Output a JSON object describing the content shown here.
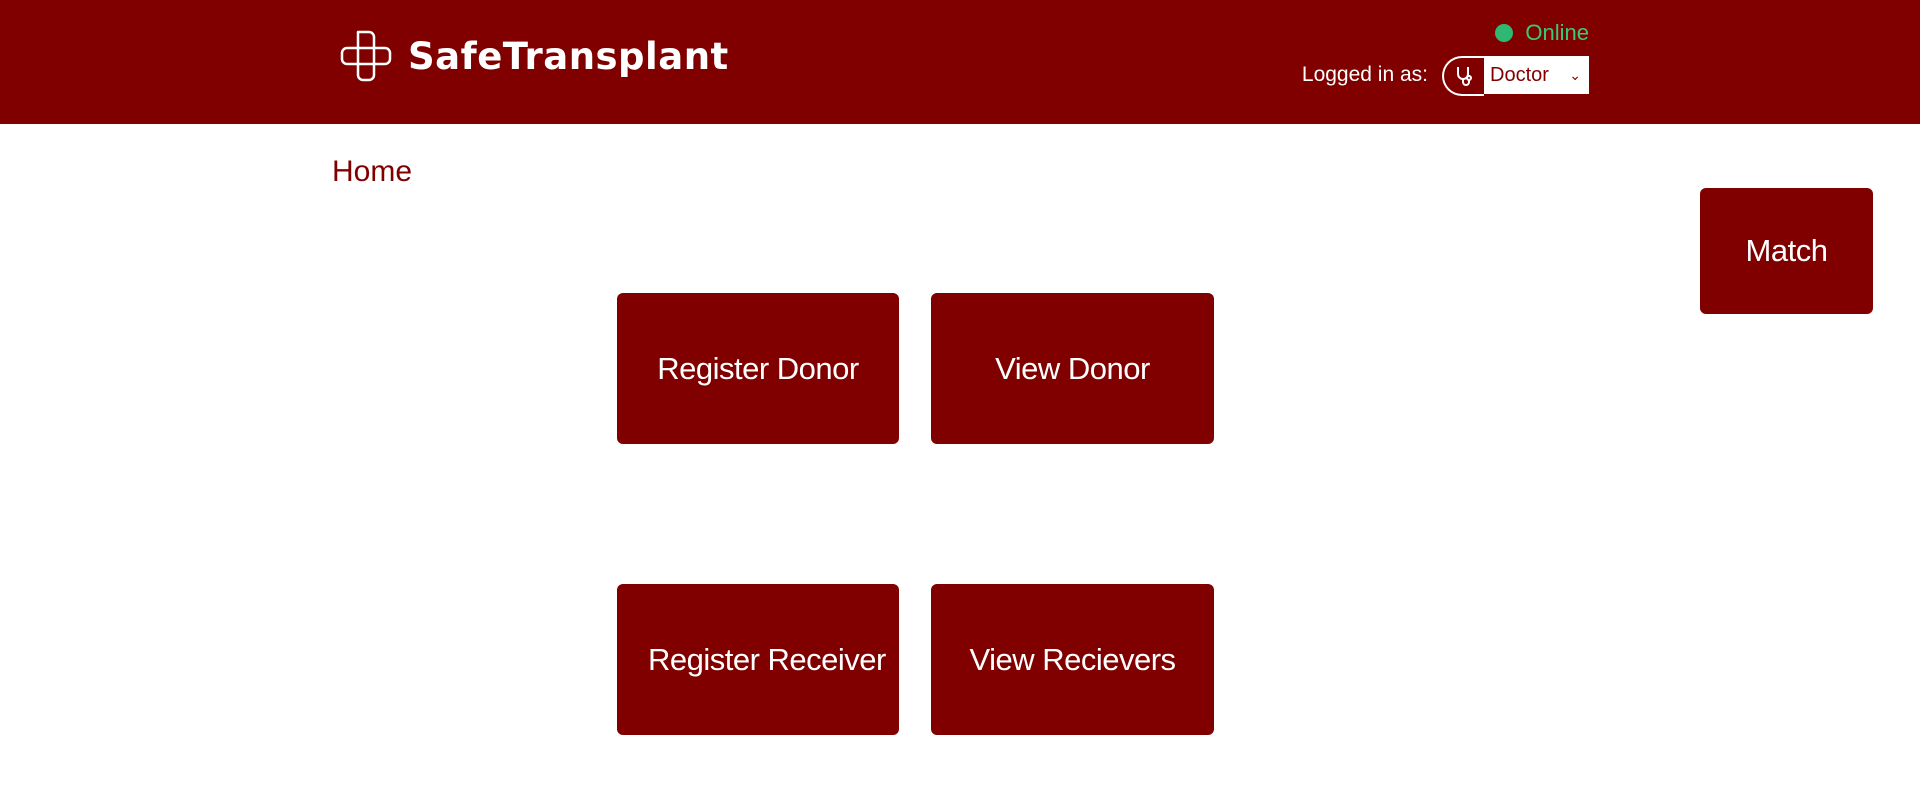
{
  "header": {
    "brand_name": "SafeTransplant",
    "logo_icon": "medical-cross-icon",
    "status_text": "Online",
    "status_color": "#2eb872",
    "logged_in_label": "Logged in as:",
    "role_icon": "stethoscope-icon",
    "role_value": "Doctor"
  },
  "page": {
    "title": "Home"
  },
  "actions": {
    "match": "Match",
    "register_donor": "Register Donor",
    "view_donor": "View Donor",
    "register_receiver": "Register Receiver",
    "view_receivers": "View Recievers"
  },
  "colors": {
    "brand": "#800000",
    "background": "#ffffff",
    "online": "#2eb872"
  }
}
